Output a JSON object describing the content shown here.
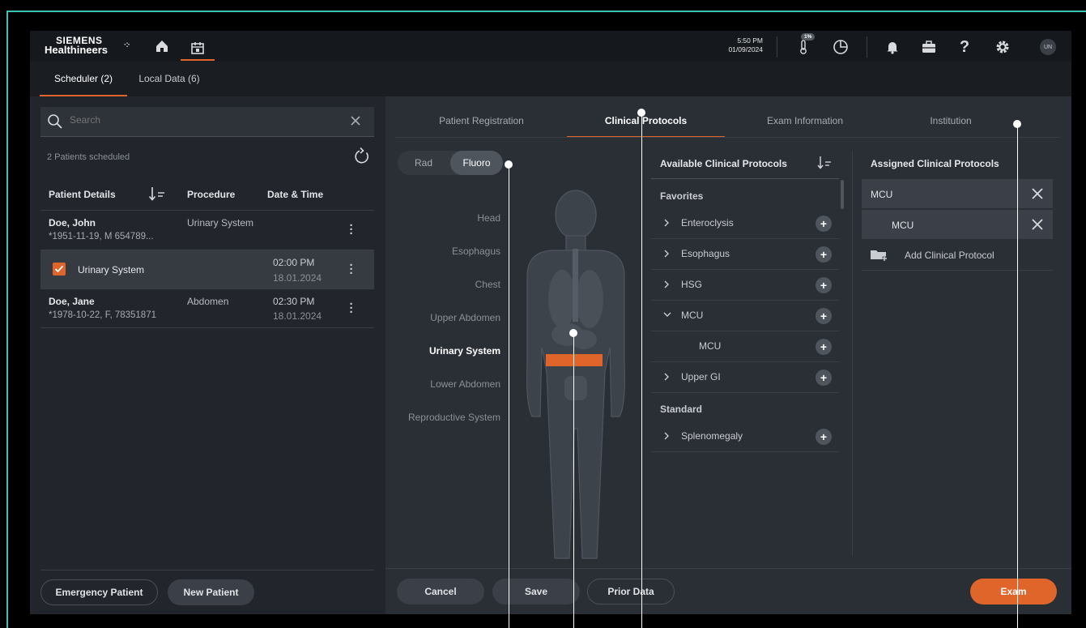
{
  "header": {
    "logo_line1": "SIEMENS",
    "logo_line2": "Healthineers",
    "time": "5:50 PM",
    "date": "01/09/2024",
    "temperature_badge": "1%",
    "user_initials": "UN",
    "accent_color": "#e0652a"
  },
  "subtabs": {
    "scheduler": "Scheduler (2)",
    "local_data": "Local Data (6)"
  },
  "search": {
    "placeholder": "Search"
  },
  "patients": {
    "count_label": "2 Patients scheduled",
    "columns": {
      "details": "Patient Details",
      "procedure": "Procedure",
      "datetime": "Date & Time"
    },
    "rows": [
      {
        "name": "Doe, John",
        "sub": "*1951-11-19, M 654789...",
        "procedure": "Urinary System",
        "time": "",
        "date": ""
      },
      {
        "name": "Urinary System",
        "sub": "",
        "procedure": "",
        "time": "02:00 PM",
        "date": "18.01.2024"
      },
      {
        "name": "Doe, Jane",
        "sub": "*1978-10-22, F, 78351871",
        "procedure": "Abdomen",
        "time": "02:30 PM",
        "date": "18.01.2024"
      }
    ]
  },
  "left_buttons": {
    "emergency": "Emergency Patient",
    "new_patient": "New Patient"
  },
  "main_tabs": [
    "Patient Registration",
    "Clinical Protocols",
    "Exam Information",
    "Institution"
  ],
  "toggle": {
    "rad": "Rad",
    "fluoro": "Fluoro"
  },
  "regions": [
    "Head",
    "Esophagus",
    "Chest",
    "Upper Abdomen",
    "Urinary System",
    "Lower Abdomen",
    "Reproductive System"
  ],
  "available": {
    "title": "Available Clinical Protocols",
    "favorites_label": "Favorites",
    "favorites": [
      "Enteroclysis",
      "Esophagus",
      "HSG",
      "MCU"
    ],
    "mcu_child": "MCU",
    "favorites_after": [
      "Upper GI"
    ],
    "standard_label": "Standard",
    "standard": [
      "Splenomegaly"
    ]
  },
  "assigned": {
    "title": "Assigned Clinical Protocols",
    "items": [
      "MCU",
      "MCU"
    ],
    "add_label": "Add Clinical Protocol"
  },
  "bottom_buttons": {
    "cancel": "Cancel",
    "save": "Save",
    "prior": "Prior Data",
    "exam": "Exam"
  }
}
